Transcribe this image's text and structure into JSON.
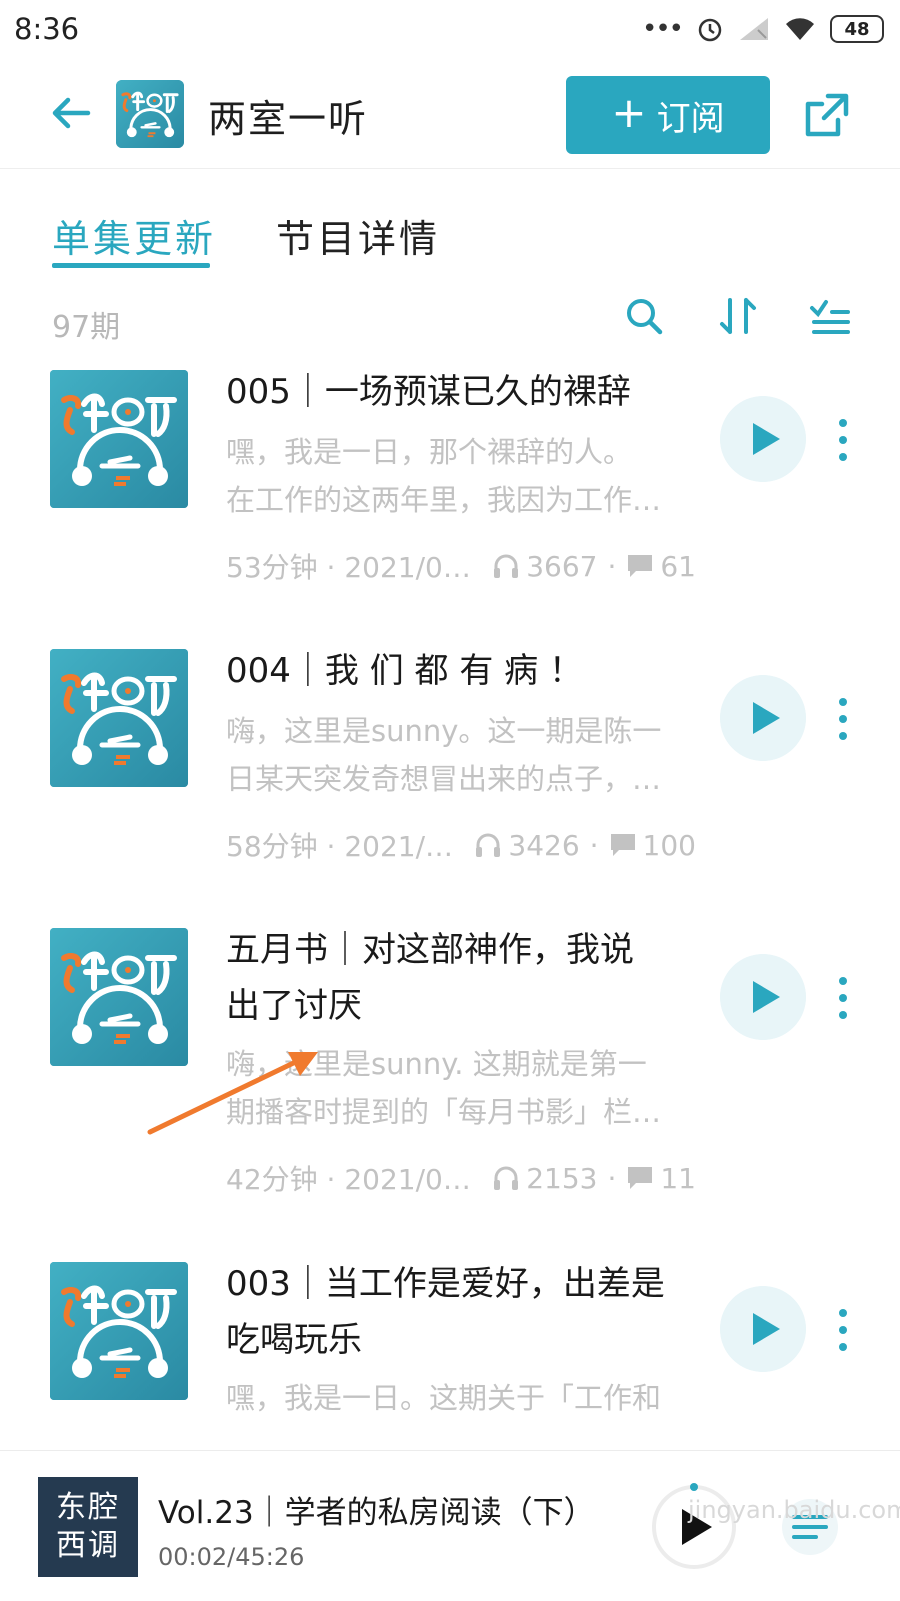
{
  "status_bar": {
    "time": "8:36",
    "battery": "48"
  },
  "header": {
    "title": "两室一听",
    "subscribe_label": "订阅",
    "subscribe_plus": "+"
  },
  "tabs": [
    {
      "label": "单集更新",
      "active": true
    },
    {
      "label": "节目详情",
      "active": false
    }
  ],
  "episode_count": "97期",
  "episodes": [
    {
      "title_lines": [
        "005｜一场预谋已久的裸辞"
      ],
      "desc_lines": [
        "嘿，我是一日，那个裸辞的人。",
        "在工作的这两年里，我因为工作…"
      ],
      "duration_date": "53分钟 · 2021/0…",
      "plays": "3667",
      "comments": "61"
    },
    {
      "title_lines": [
        "004｜我 们 都 有 病 ！"
      ],
      "desc_lines": [
        "嗨，这里是sunny。这一期是陈一",
        "日某天突发奇想冒出来的点子，…"
      ],
      "duration_date": "58分钟 · 2021/…",
      "plays": "3426",
      "comments": "100"
    },
    {
      "title_lines": [
        "五月书｜对这部神作，我说",
        "出了讨厌"
      ],
      "desc_lines": [
        "嗨，这里是sunny. 这期就是第一",
        "期播客时提到的「每月书影」栏…"
      ],
      "duration_date": "42分钟 · 2021/0…",
      "plays": "2153",
      "comments": "11"
    },
    {
      "title_lines": [
        "003｜当工作是爱好，出差是",
        "吃喝玩乐"
      ],
      "desc_lines": [
        "嘿，我是一日。这期关于「工作和"
      ],
      "duration_date": "",
      "plays": "",
      "comments": ""
    }
  ],
  "player": {
    "cover_line1": "东腔",
    "cover_line2": "西调",
    "title": "Vol.23｜学者的私房阅读（下）",
    "time": "00:02/45:26",
    "progress": 0.001
  },
  "watermark": "jingyan.baidu.com",
  "colors": {
    "accent": "#2aa7bf",
    "cover_bg": "#3a9fb5",
    "orange": "#f07a2e",
    "annotation_arrow": "#f07a2e"
  }
}
